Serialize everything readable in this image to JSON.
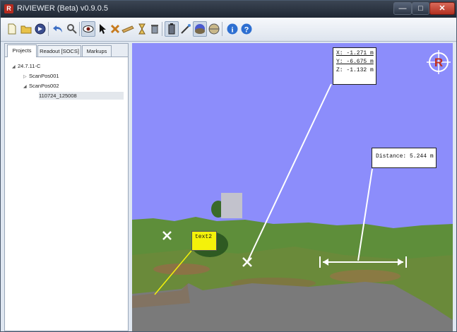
{
  "window": {
    "title": "RiVIEWER (Beta) v0.9.0.5",
    "app_icon_letter": "R",
    "minimize_glyph": "—",
    "maximize_glyph": "□",
    "close_glyph": "✕"
  },
  "toolbar": {
    "buttons": [
      {
        "icon": "new-file-icon",
        "glyph": "📄"
      },
      {
        "icon": "open-folder-icon",
        "glyph": "📂"
      },
      {
        "icon": "navigate-icon",
        "glyph": "◉"
      },
      {
        "icon": "undo-icon",
        "glyph": "↶"
      },
      {
        "icon": "search-icon",
        "glyph": "🔍"
      },
      {
        "icon": "eye-icon",
        "glyph": "👁"
      },
      {
        "icon": "pointer-icon",
        "glyph": "↖"
      },
      {
        "icon": "delete-icon",
        "glyph": "✖"
      },
      {
        "icon": "measure-icon",
        "glyph": "📏"
      },
      {
        "icon": "hourglass-icon",
        "glyph": "⌛"
      },
      {
        "icon": "trash-icon",
        "glyph": "🗑"
      },
      {
        "icon": "battery-icon",
        "glyph": "▮"
      },
      {
        "icon": "wand-icon",
        "glyph": "✎"
      },
      {
        "icon": "sphere-icon",
        "glyph": "●"
      },
      {
        "icon": "panorama-icon",
        "glyph": "◐"
      },
      {
        "icon": "info-icon",
        "glyph": "i"
      },
      {
        "icon": "help-icon",
        "glyph": "?"
      }
    ]
  },
  "left_panel": {
    "tabs": [
      "Projects",
      "Readout [SOCS]",
      "Markups"
    ],
    "tree": [
      {
        "label": "24.7.11-C",
        "expanded": true,
        "level": 0
      },
      {
        "label": "ScanPos001",
        "expanded": false,
        "level": 1
      },
      {
        "label": "ScanPos002",
        "expanded": true,
        "level": 1
      },
      {
        "label": "110724_125008",
        "expanded": false,
        "level": 2,
        "selected": true
      }
    ]
  },
  "viewport": {
    "coords": {
      "x": "X: -1.271 m",
      "y": "Y: -6.675 m",
      "z": "Z: -1.132 m"
    },
    "distance": "Distance: 5.244 m",
    "text_markup": "text2",
    "logo_letter": "R",
    "colors": {
      "sky": "#8c8dfb",
      "ground": "#5c8a34",
      "road": "#7a7a7a",
      "note": "#f4f20a"
    }
  }
}
